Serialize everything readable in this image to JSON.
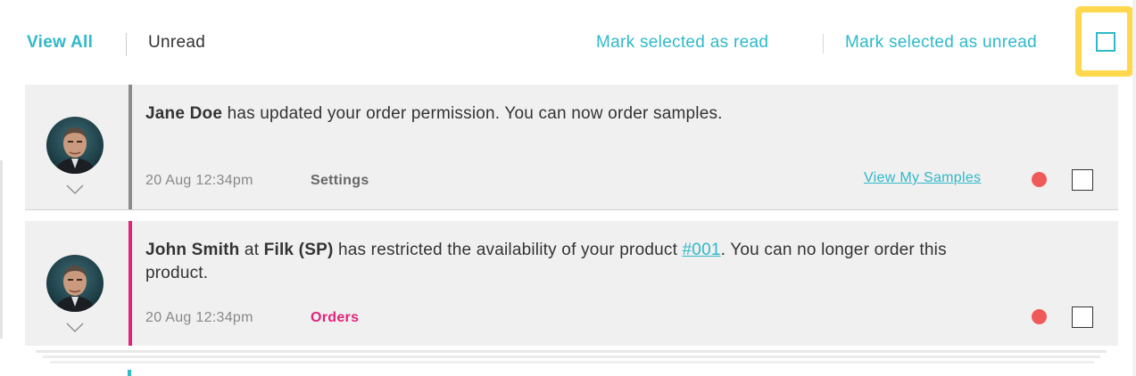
{
  "tabs": {
    "view_all": "View All",
    "unread": "Unread"
  },
  "actions": {
    "mark_read": "Mark selected as read",
    "mark_unread": "Mark selected as unread"
  },
  "colors": {
    "accent": "#2fb9c9",
    "orders_category": "#e0247a",
    "unread_dot": "#f05a5a",
    "highlight": "#ffd84d"
  },
  "notifications": [
    {
      "actor": "Jane Doe",
      "text": " has updated your order permission. You can now order samples.",
      "time": "20 Aug 12:34pm",
      "category": "Settings",
      "link": "View My Samples",
      "unread": true,
      "icon": "avatar-photo"
    },
    {
      "actor": "John Smith",
      "at": " at ",
      "company": "Filk (SP)",
      "text_before_link": " has restricted the availability of your product ",
      "product_link": "#001",
      "text_after_link": ". You can no longer order this product.",
      "time": "20 Aug 12:34pm",
      "category": "Orders",
      "unread": true,
      "icon": "avatar-photo"
    }
  ]
}
